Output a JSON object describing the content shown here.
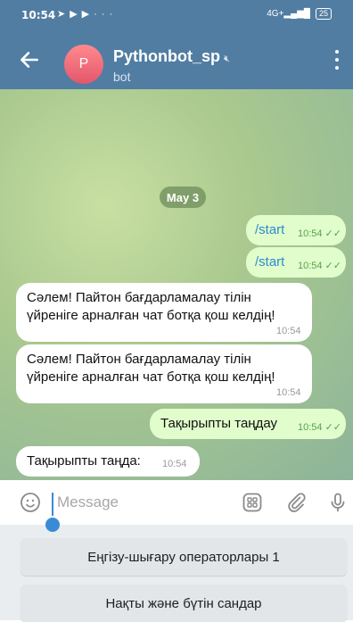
{
  "status": {
    "time": "10:54",
    "network": "4G+",
    "battery": "25"
  },
  "header": {
    "title": "Pythonbot_sp",
    "subtitle": "bot",
    "avatar_letter": "P"
  },
  "chat": {
    "date_chip": "May 3",
    "messages": [
      {
        "dir": "out",
        "text": "/start",
        "time": "10:54"
      },
      {
        "dir": "out",
        "text": "/start",
        "time": "10:54"
      },
      {
        "dir": "in",
        "text_line1": "Сәлем! Пайтон бағдарламалау тілін",
        "text_line2": "үйреніге арналған чат ботқа қош келдің!",
        "time": "10:54"
      },
      {
        "dir": "in",
        "text_line1": "Сәлем! Пайтон бағдарламалау тілін",
        "text_line2": "үйреніге арналған чат ботқа қош келдің!",
        "time": "10:54"
      },
      {
        "dir": "out",
        "text": "Тақырыпты таңдау",
        "time": "10:54"
      },
      {
        "dir": "in",
        "text": "Тақырыпты таңда:",
        "time": "10:54"
      }
    ]
  },
  "input": {
    "placeholder": "Message"
  },
  "keyboard": {
    "buttons": [
      "Еңгізу-шығару операторлары 1",
      "Нақты және бүтін сандар"
    ]
  },
  "colors": {
    "header": "#517da2",
    "outgoing_bubble": "#e1fdcb",
    "incoming_bubble": "#ffffff",
    "accent": "#3a8bd6"
  }
}
